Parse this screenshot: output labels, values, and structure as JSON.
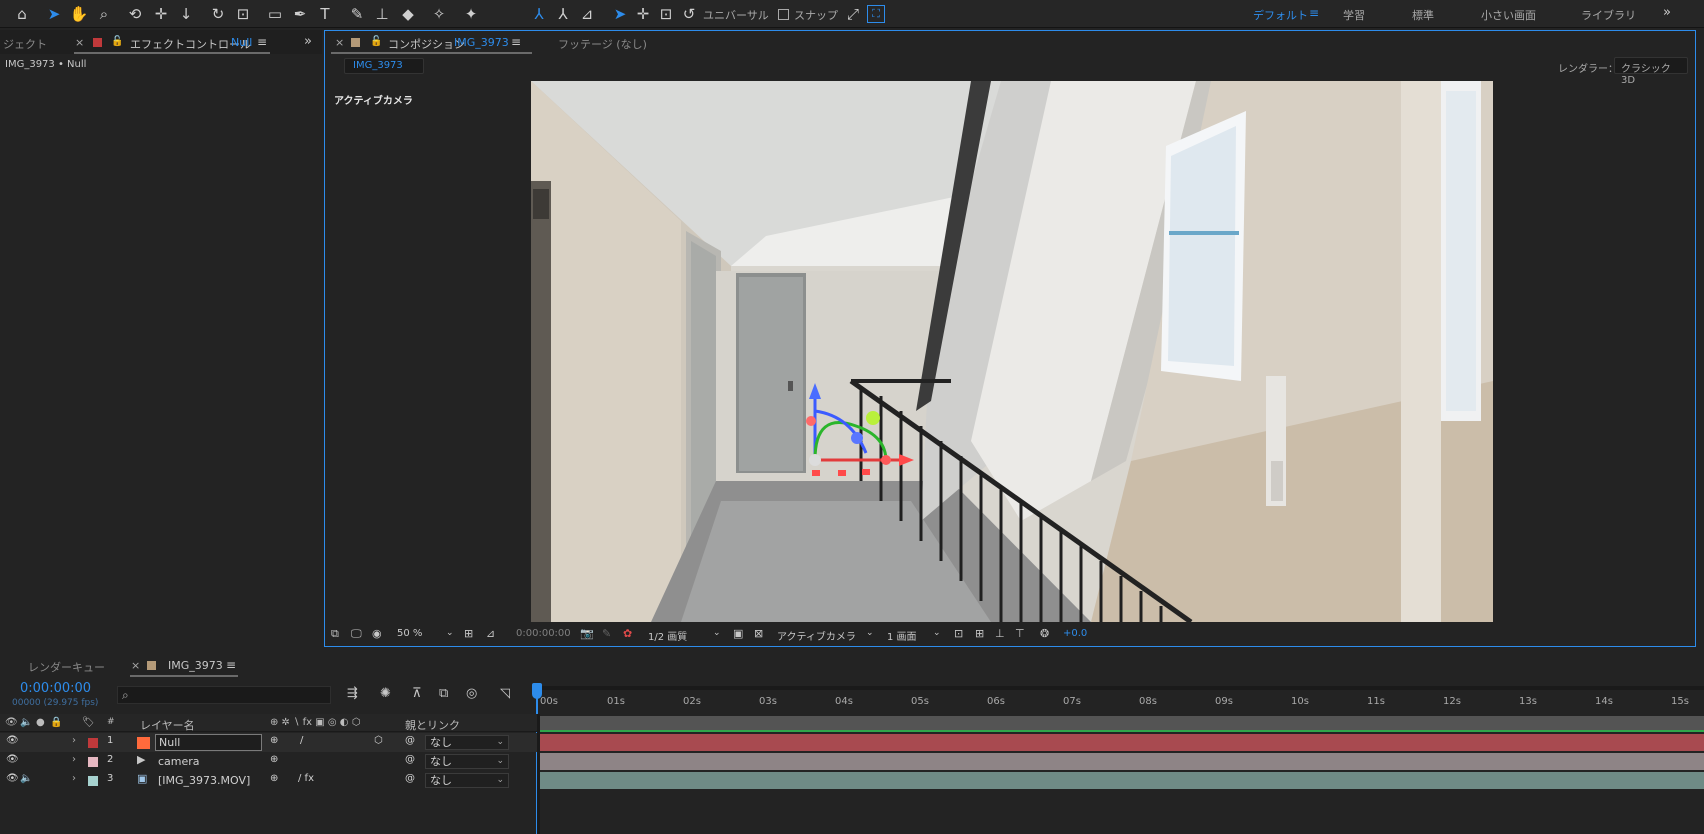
{
  "toolbar": {
    "universal_label": "ユニバーサル",
    "snap_label": "スナップ",
    "workspaces": [
      "デフォルト",
      "学習",
      "標準",
      "小さい画面",
      "ライブラリ"
    ],
    "active_workspace": "デフォルト"
  },
  "left_panel": {
    "project_tab": "ジェクト",
    "effects_tab_label": "エフェクトコントロール",
    "effects_tab_layer": "Null",
    "subtitle": "IMG_3973 • Null"
  },
  "comp_panel": {
    "tab_label": "コンポジション",
    "tab_comp": "IMG_3973",
    "footage_tab": "フッテージ (なし)",
    "breadcrumb": "IMG_3973",
    "renderer_label": "レンダラー：",
    "renderer_value": "クラシック 3D",
    "active_camera_label": "アクティブカメラ"
  },
  "viewer_bar": {
    "zoom": "50 %",
    "timecode": "0:00:00:00",
    "resolution": "1/2 画質",
    "view": "アクティブカメラ",
    "layout": "1 画面",
    "exposure": "+0.0"
  },
  "timeline": {
    "render_queue_tab": "レンダーキュー",
    "comp_tab": "IMG_3973",
    "current_time": "0:00:00:00",
    "frame_info": "00000 (29.975 fps)",
    "search_placeholder": "",
    "ruler": [
      "00s",
      "01s",
      "02s",
      "03s",
      "04s",
      "05s",
      "06s",
      "07s",
      "08s",
      "09s",
      "10s",
      "11s",
      "12s",
      "13s",
      "14s",
      "15s"
    ],
    "col_hash": "#",
    "col_layer_name": "レイヤー名",
    "col_parent": "親とリンク",
    "layers": [
      {
        "num": "1",
        "name": "Null",
        "parent": "なし",
        "label_color": "#c0393b",
        "bar_color": "#a84a50"
      },
      {
        "num": "2",
        "name": "camera",
        "parent": "なし",
        "label_color": "#e6b8c2",
        "bar_color": "#8e8486"
      },
      {
        "num": "3",
        "name": "[IMG_3973.MOV]",
        "parent": "なし",
        "label_color": "#a6d2cf",
        "bar_color": "#6f8b86"
      }
    ]
  },
  "colors": {
    "accent": "#2d8ceb",
    "panel_bg": "#232323"
  }
}
